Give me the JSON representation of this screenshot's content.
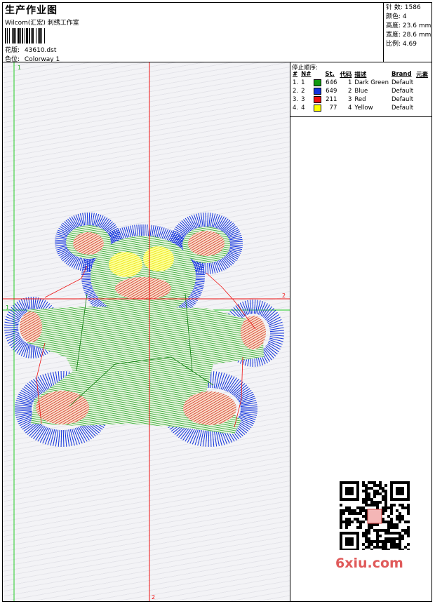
{
  "header": {
    "title": "生产作业图",
    "studio": "Wilcom(汇宏) 刺绣工作室",
    "design_label": "花版:",
    "design_value": "43610.dst",
    "colorway_label": "色位:",
    "colorway_value": "Colorway 1"
  },
  "stats": {
    "stitches_label": "针 数:",
    "stitches_value": "1586",
    "colors_label": "颜色:",
    "colors_value": "4",
    "height_label": "高度:",
    "height_value": "23.6 mm",
    "width_label": "宽度:",
    "width_value": "28.6 mm",
    "scale_label": "比例:",
    "scale_value": "4.69"
  },
  "stop_sequence": {
    "label": "停止顺序:",
    "columns": [
      "#",
      "N#",
      "St.",
      "代码",
      "描述",
      "Brand",
      "元素"
    ],
    "rows": [
      {
        "idx": "1.",
        "n": "1",
        "st": "646",
        "code": "1",
        "desc": "Dark Green",
        "brand": "Default",
        "color": "#119911"
      },
      {
        "idx": "2.",
        "n": "2",
        "st": "649",
        "code": "2",
        "desc": "Blue",
        "brand": "Default",
        "color": "#1133dd"
      },
      {
        "idx": "3.",
        "n": "3",
        "st": "211",
        "code": "3",
        "desc": "Red",
        "brand": "Default",
        "color": "#ee1111"
      },
      {
        "idx": "4.",
        "n": "4",
        "st": "77",
        "code": "4",
        "desc": "Yellow",
        "brand": "Default",
        "color": "#ffff00"
      }
    ]
  },
  "canvas": {
    "guide_v_green_label": "1",
    "guide_h_green_label": "1",
    "guide_h_red_label": "2",
    "guide_v_red_label": "2"
  },
  "watermark": {
    "site": "6xiu.com"
  },
  "thread_colors": {
    "dark_green": "#119911",
    "blue": "#1133dd",
    "red": "#ee1111",
    "yellow": "#ffff00"
  }
}
